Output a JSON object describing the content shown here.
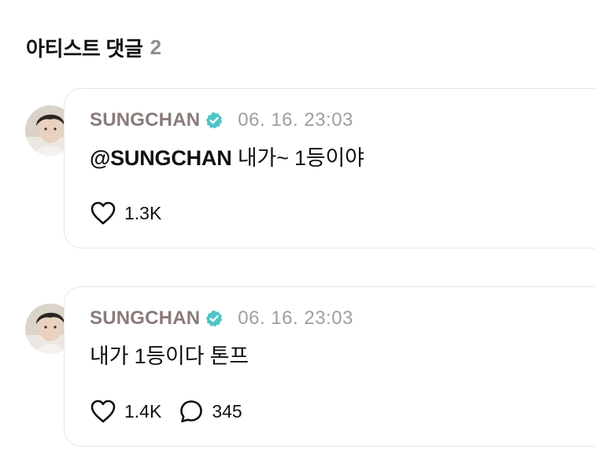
{
  "section": {
    "title": "아티스트 댓글",
    "count": "2"
  },
  "comments": [
    {
      "author": "SUNGCHAN",
      "timestamp": "06. 16. 23:03",
      "mention": "@SUNGCHAN",
      "text": " 내가~ 1등이야",
      "likes": "1.3K",
      "verified_icon": "verified-badge-icon",
      "like_icon": "heart-outline-icon"
    },
    {
      "author": "SUNGCHAN",
      "timestamp": "06. 16. 23:03",
      "text": "내가 1등이다 톤프",
      "likes": "1.4K",
      "replies": "345",
      "verified_icon": "verified-badge-icon",
      "like_icon": "heart-outline-icon",
      "reply_icon": "speech-bubble-icon"
    }
  ],
  "colors": {
    "author": "#8a7a7a",
    "verified": "#4fc4c8",
    "timestamp": "#9e9e9e",
    "count": "#8e8e8e",
    "card_border": "#e7e7e7"
  }
}
